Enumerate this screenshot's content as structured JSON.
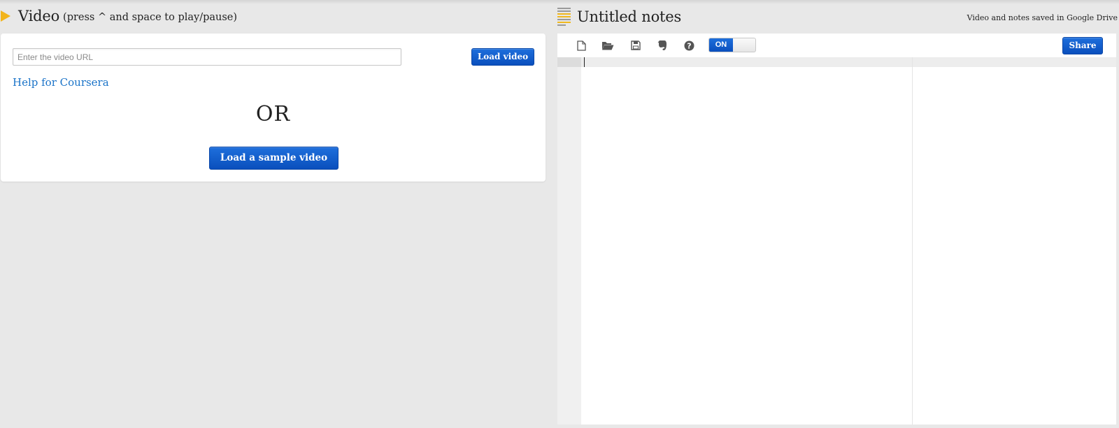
{
  "video": {
    "title": "Video",
    "hint": "(press ^ and space to play/pause)",
    "url_placeholder": "Enter the video URL",
    "url_value": "",
    "load_button": "Load video",
    "help_link": "Help for Coursera",
    "or_text": "OR",
    "sample_button": "Load a sample video"
  },
  "notes": {
    "title": "Untitled notes",
    "saved_status": "Video and notes saved in Google Drive",
    "toolbar": {
      "icons": [
        "new-file-icon",
        "open-folder-icon",
        "save-icon",
        "evernote-icon",
        "help-icon"
      ],
      "toggle_label": "ON",
      "toggle_state": "on",
      "share_button": "Share"
    },
    "editor_content": ""
  },
  "colors": {
    "accent_blue": "#0a4fbd",
    "link_blue": "#1a73c8",
    "play_icon": "#f2b41b",
    "background": "#e8e8e8"
  }
}
